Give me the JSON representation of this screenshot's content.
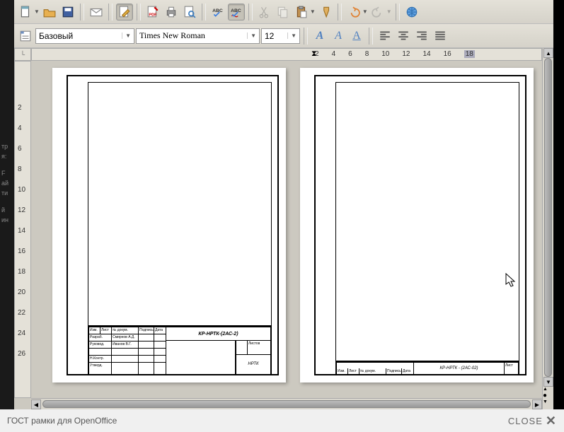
{
  "toolbar1": {
    "new_doc": "new-doc",
    "open": "open",
    "save": "save",
    "mail": "mail",
    "edit_doc": "edit",
    "pdf": "PDF",
    "print": "print",
    "preview": "preview",
    "spell_auto": "ABC",
    "spell_check": "ABC",
    "cut": "cut",
    "copy": "copy",
    "paste": "paste",
    "brush": "brush",
    "undo": "undo",
    "redo": "redo",
    "link": "link"
  },
  "toolbar2": {
    "styles_btn": "styles",
    "style_value": "Базовый",
    "font_value": "Times New Roman",
    "size_value": "12",
    "bold": "A",
    "italic": "A",
    "underline": "A",
    "align_left": "left",
    "align_center": "center",
    "align_right": "right",
    "align_justify": "justify"
  },
  "ruler": {
    "h": [
      "2",
      "4",
      "6",
      "8",
      "10",
      "12",
      "14",
      "16",
      "18"
    ],
    "v": [
      "2",
      "4",
      "6",
      "8",
      "10",
      "12",
      "14",
      "16",
      "18",
      "20",
      "22",
      "24",
      "26"
    ]
  },
  "pages": {
    "page1": {
      "doc_code": "КР-НРТК-(2АС-2)",
      "org": "НРТК",
      "rows": {
        "r1": "Изм.",
        "r1b": "Лист",
        "r1c": "№ докум.",
        "r1d": "Подпись",
        "r1e": "Дата",
        "r2a": "Разраб.",
        "r2b": "Смирнов А.Д.",
        "r3a": "Руковод.",
        "r3b": "Иванов В.Г.",
        "r4a": "Н.Контр.",
        "r5a": "Утверд.",
        "sheets": "Листов"
      }
    },
    "page2": {
      "doc_code": "КР-НРТК - (2АС-02)",
      "sheet": "Лист",
      "rows": {
        "r1": "Изм.",
        "r1b": "Лист",
        "r1c": "№ докум.",
        "r1d": "Подпись",
        "r1e": "Дата"
      }
    }
  },
  "footer": {
    "caption": "ГОСТ рамки для OpenOffice",
    "close": "CLOSE"
  },
  "left_strip": [
    "тр",
    "я:",
    "F",
    "ай",
    "ти",
    "й",
    "ин"
  ]
}
